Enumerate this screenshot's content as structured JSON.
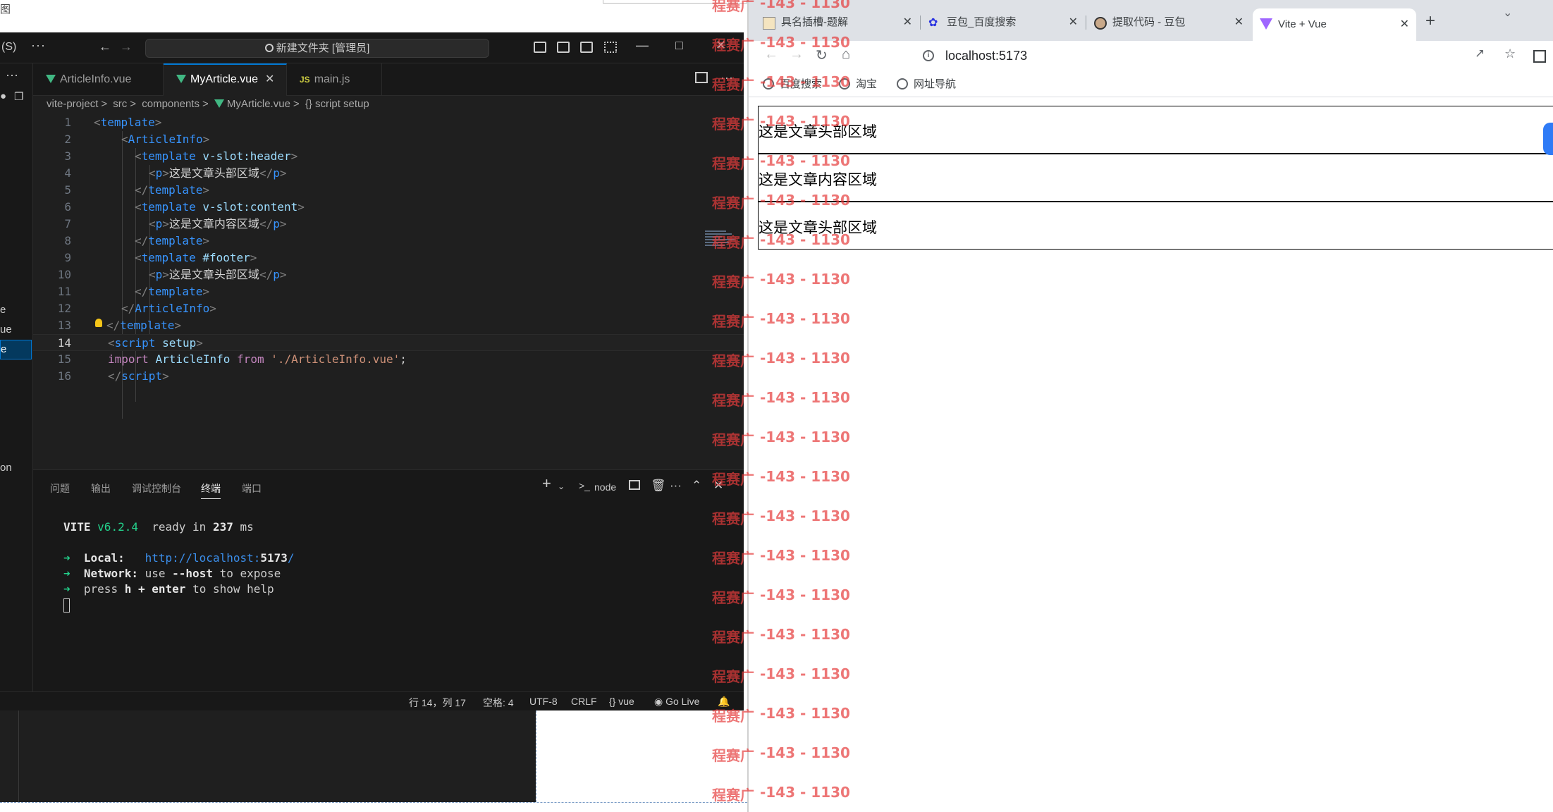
{
  "desktop": {
    "top_left_text": "图"
  },
  "vscode": {
    "menu_fragment": "(S)",
    "more": "···",
    "search_text": "新建文件夹 [管理员]",
    "tabs": [
      {
        "label": "ArticleInfo.vue",
        "icon": "vue-icon"
      },
      {
        "label": "MyArticle.vue",
        "icon": "vue-icon",
        "close": "✕"
      },
      {
        "label": "main.js",
        "icon": "js-icon",
        "icon_text": "JS"
      }
    ],
    "breadcrumb": [
      "vite-project",
      "src",
      "components",
      "MyArticle.vue",
      "{} script setup"
    ],
    "breadcrumb_sep": ">",
    "explorer_fragments": [
      "e",
      "ue",
      "e",
      "on"
    ],
    "line_numbers": [
      "1",
      "2",
      "3",
      "4",
      "5",
      "6",
      "7",
      "8",
      "9",
      "10",
      "11",
      "12",
      "13",
      "14",
      "15",
      "16"
    ],
    "code": {
      "l1_tag": "template",
      "l2_tag": "ArticleInfo",
      "l3_tag": "template",
      "l3_attr": "v-slot:header",
      "l4_tag": "p",
      "l4_text": "这是文章头部区域",
      "l5_tag": "template",
      "l6_tag": "template",
      "l6_attr": "v-slot:content",
      "l7_tag": "p",
      "l7_text": "这是文章内容区域",
      "l8_tag": "template",
      "l9_tag": "template",
      "l9_attr": "#footer",
      "l10_tag": "p",
      "l10_text": "这是文章头部区域",
      "l11_tag": "template",
      "l12_tag": "ArticleInfo",
      "l13_tag": "template",
      "l14_tag": "script",
      "l14_attr": "setup",
      "l15_kw1": "import",
      "l15_id": "ArticleInfo",
      "l15_kw2": "from",
      "l15_str": "'./ArticleInfo.vue'",
      "l15_end": ";",
      "l16_tag": "script"
    },
    "panel_tabs": [
      "问题",
      "输出",
      "调试控制台",
      "终端",
      "端口"
    ],
    "panel_active": "终端",
    "terminal_shell": "node",
    "terminal": {
      "vite": "VITE",
      "version": "v6.2.4",
      "ready": "ready in",
      "ms_value": "237",
      "ms": "ms",
      "arrow": "➜",
      "local_label": "Local:",
      "local_url_prefix": "http://localhost:",
      "local_url_port": "5173",
      "local_url_suffix": "/",
      "network_label": "Network:",
      "network_use": "use",
      "network_flag": "--host",
      "network_rest": "to expose",
      "press": "press",
      "press_key": "h + enter",
      "press_rest": "to show help"
    },
    "status": {
      "position": "行 14，列 17",
      "spaces": "空格: 4",
      "encoding": "UTF-8",
      "eol": "CRLF",
      "language": "vue",
      "golive": "Go Live"
    }
  },
  "browser": {
    "tabs": [
      {
        "label": "具名插槽-题解",
        "icon": "image-icon"
      },
      {
        "label": "豆包_百度搜索",
        "icon": "baidu-icon"
      },
      {
        "label": "提取代码 - 豆包",
        "icon": "doubao-icon"
      },
      {
        "label": "Vite + Vue",
        "icon": "vite-icon",
        "active": true
      }
    ],
    "tab_close": "✕",
    "new_tab": "+",
    "url": "localhost:5173",
    "bookmarks": [
      "百度搜索",
      "淘宝",
      "网址导航"
    ],
    "content": [
      "这是文章头部区域",
      "这是文章内容区域",
      "这是文章头部区域"
    ]
  },
  "watermark": {
    "text_a": "程赛广",
    "text_b": "-143 - 1130"
  },
  "colors": {
    "vscode_bg": "#1f1f1f",
    "accent": "#0078d4",
    "vue_green": "#41b883",
    "watermark": "#e63c3c"
  }
}
